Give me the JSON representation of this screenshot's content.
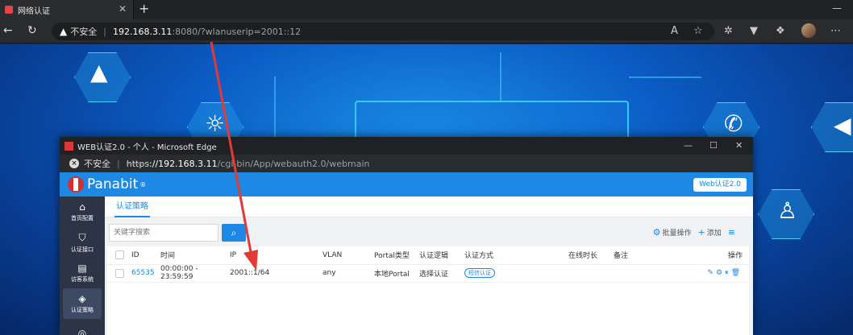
{
  "browser": {
    "tab_title": "网络认证",
    "tab_close": "✕",
    "new_tab": "+",
    "security_label": "不安全",
    "url_host": "192.168.3.11",
    "url_rest": ":8080/?wlanuserip=2001::12"
  },
  "popup": {
    "title": "WEB认证2.0 - 个人 - Microsoft Edge",
    "security_label": "不安全",
    "url_scheme": "https",
    "url_host": "://192.168.3.11",
    "url_rest": "/cgi-bin/App/webauth2.0/webmain"
  },
  "app": {
    "logo_text": "Panabit",
    "logo_reg": "®",
    "version_button": "Web认证2.0",
    "sidebar": [
      {
        "label": "首页配置",
        "icon": "home-icon"
      },
      {
        "label": "认证接口",
        "icon": "shield-icon"
      },
      {
        "label": "访客系统",
        "icon": "clipboard-icon"
      },
      {
        "label": "认证策略",
        "icon": "stack-icon"
      }
    ],
    "page_tab": "认证策略",
    "search_placeholder": "关键字搜索",
    "batch_label": "批量操作",
    "add_label": "添加",
    "table": {
      "headers": [
        "ID",
        "时间",
        "IP",
        "VLAN",
        "Portal类型",
        "认证逻辑",
        "认证方式",
        "在线时长",
        "备注",
        "操作"
      ],
      "rows": [
        {
          "id": "65535",
          "time": "00:00:00 - 23:59:59",
          "ip": "2001::1/64",
          "vlan": "any",
          "portal": "本地Portal",
          "logic": "选择认证",
          "method": "短信认证",
          "online": "",
          "remark": ""
        }
      ]
    }
  }
}
